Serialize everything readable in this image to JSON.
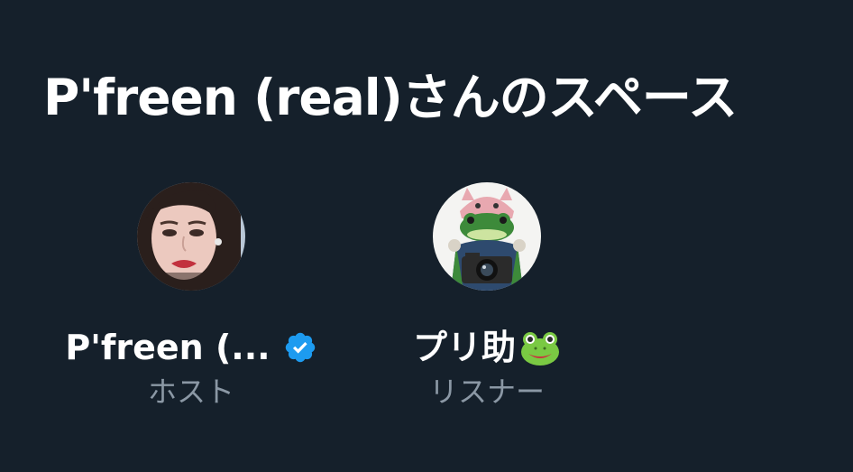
{
  "space": {
    "title": "P'freen (real)さんのスペース"
  },
  "participants": [
    {
      "name": "P'freen (...",
      "role": "ホスト",
      "verified": true,
      "avatar": "woman-portrait-avatar"
    },
    {
      "name": "プリ助",
      "role": "リスナー",
      "name_emoji_icon": "frog-face-icon",
      "avatar": "frog-with-camera-avatar"
    }
  ],
  "colors": {
    "background": "#15202b",
    "primary_text": "#ffffff",
    "secondary_text": "#8b98a5",
    "verified_badge": "#1d9bf0"
  }
}
